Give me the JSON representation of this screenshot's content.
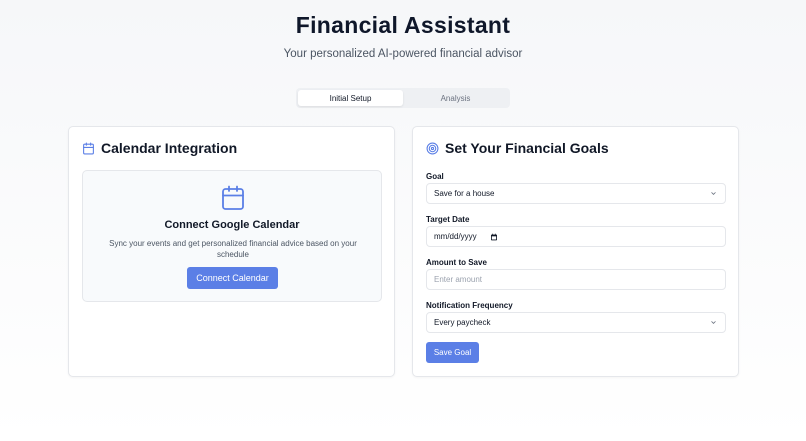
{
  "header": {
    "title": "Financial Assistant",
    "subtitle": "Your personalized AI-powered financial advisor"
  },
  "tabs": [
    {
      "label": "Initial Setup",
      "active": true
    },
    {
      "label": "Analysis",
      "active": false
    }
  ],
  "calendar_card": {
    "title": "Calendar Integration",
    "icon": "calendar-icon",
    "connect_title": "Connect Google Calendar",
    "connect_description": "Sync your events and get personalized financial advice based on your schedule",
    "connect_button": "Connect Calendar"
  },
  "goals_card": {
    "title": "Set Your Financial Goals",
    "icon": "target-icon",
    "goal": {
      "label": "Goal",
      "value": "Save for a house"
    },
    "target_date": {
      "label": "Target Date",
      "value": "mm/dd/yyyy"
    },
    "amount": {
      "label": "Amount to Save",
      "placeholder": "Enter amount"
    },
    "frequency": {
      "label": "Notification Frequency",
      "value": "Every paycheck"
    },
    "save_button": "Save Goal"
  },
  "colors": {
    "accent": "#5b7fe6",
    "text": "#111827",
    "muted": "#4b5563",
    "border": "#e5e7eb"
  }
}
